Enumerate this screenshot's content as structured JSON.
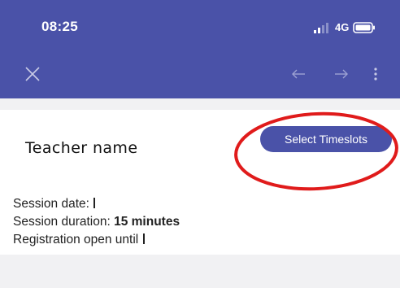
{
  "status_bar": {
    "time": "08:25",
    "network": "4G",
    "signal_icon": "signal-bars-icon",
    "battery_icon": "battery-icon"
  },
  "toolbar": {
    "close_icon": "close-icon",
    "back_icon": "arrow-left-icon",
    "forward_icon": "arrow-right-icon",
    "more_icon": "more-vertical-icon"
  },
  "session": {
    "teacher_name": "Teacher name",
    "select_button_label": "Select Timeslots",
    "date_label": "Session date:",
    "duration_label": "Session duration:",
    "duration_value": "15 minutes",
    "registration_label": "Registration open until"
  },
  "colors": {
    "primary": "#4a52a8",
    "highlight": "#e01b1b",
    "background": "#f1f1f3",
    "card": "#ffffff"
  }
}
